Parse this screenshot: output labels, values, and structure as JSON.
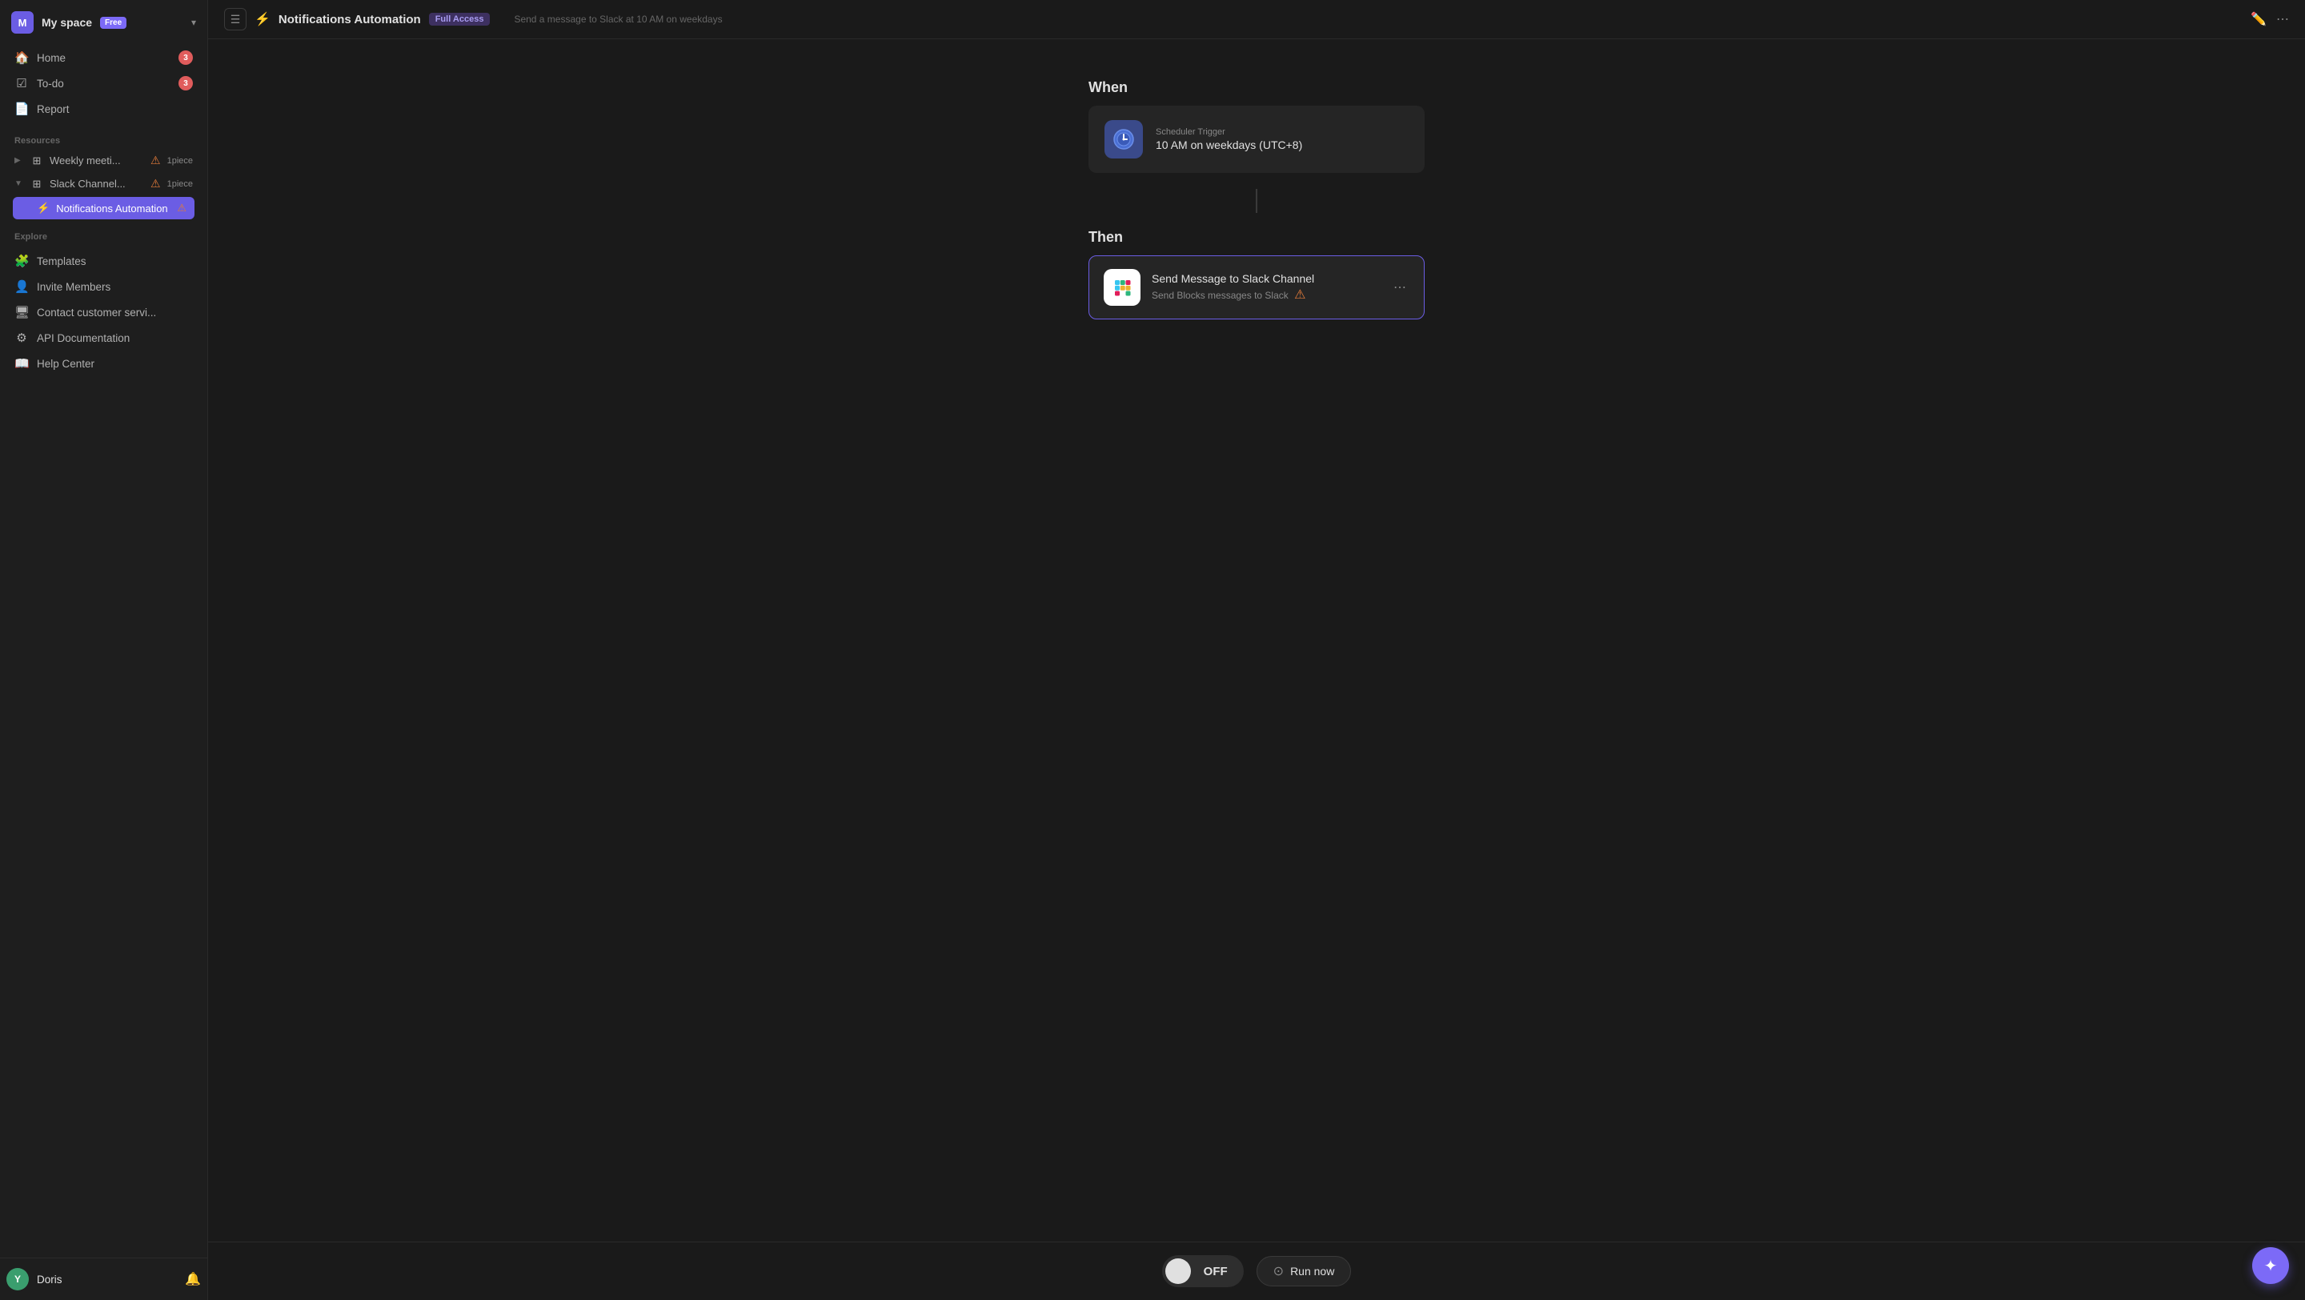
{
  "workspace": {
    "avatar_letter": "M",
    "name": "My space",
    "plan_badge": "Free"
  },
  "sidebar": {
    "nav_items": [
      {
        "id": "home",
        "icon": "🏠",
        "label": "Home",
        "badge": "3"
      },
      {
        "id": "todo",
        "icon": "☑",
        "label": "To-do",
        "badge": "3"
      },
      {
        "id": "report",
        "icon": "📄",
        "label": "Report",
        "badge": null
      }
    ],
    "resources_label": "Resources",
    "tree_items": [
      {
        "id": "weekly-meeting",
        "label": "Weekly meeti...",
        "has_warning": true,
        "count": "1piece",
        "expanded": false
      },
      {
        "id": "slack-channel",
        "label": "Slack Channel...",
        "has_warning": true,
        "count": "1piece",
        "expanded": true
      }
    ],
    "automation_item": {
      "label": "Notifications Automation",
      "has_warning": true
    },
    "explore_label": "Explore",
    "explore_items": [
      {
        "id": "templates",
        "icon": "🧩",
        "label": "Templates"
      },
      {
        "id": "invite",
        "icon": "👤",
        "label": "Invite Members"
      },
      {
        "id": "contact",
        "icon": "🖥",
        "label": "Contact customer servi..."
      },
      {
        "id": "api",
        "icon": "⚙",
        "label": "API Documentation"
      },
      {
        "id": "help",
        "icon": "📖",
        "label": "Help Center"
      }
    ]
  },
  "user": {
    "avatar_letter": "Y",
    "name": "Doris"
  },
  "topbar": {
    "automation_icon": "⚡",
    "title": "Notifications Automation",
    "access_badge": "Full Access",
    "subtitle": "Send a message to Slack at 10 AM on weekdays"
  },
  "when_section": {
    "heading": "When",
    "trigger": {
      "sub_label": "Scheduler Trigger",
      "main_label": "10 AM on weekdays (UTC+8)"
    }
  },
  "then_section": {
    "heading": "Then",
    "action": {
      "main_label": "Send Message to Slack Channel",
      "sub_label": "Send Blocks messages to Slack",
      "has_warning": true
    }
  },
  "bottom_bar": {
    "toggle_label": "OFF",
    "run_now_label": "Run now"
  }
}
